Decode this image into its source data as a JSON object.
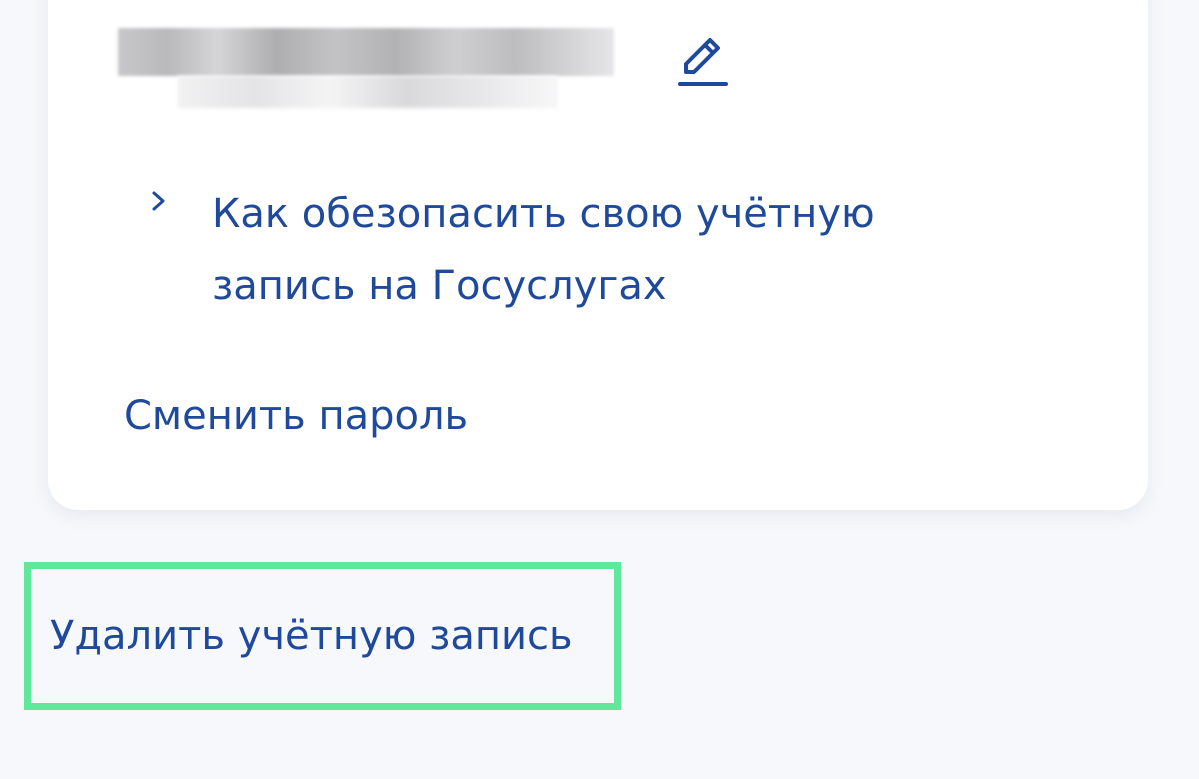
{
  "profile": {
    "blurred_value": ""
  },
  "icons": {
    "edit": "pencil-icon",
    "chevron": "chevron-right-icon"
  },
  "links": {
    "security_tip": "Как обезопасить свою учётную запись на Госуслугах",
    "change_password": "Сменить пароль",
    "delete_account": "Удалить учётную запись"
  },
  "colors": {
    "link": "#1f4a9c",
    "highlight": "#5fe89a",
    "background": "#f6f8fb",
    "card": "#ffffff"
  }
}
